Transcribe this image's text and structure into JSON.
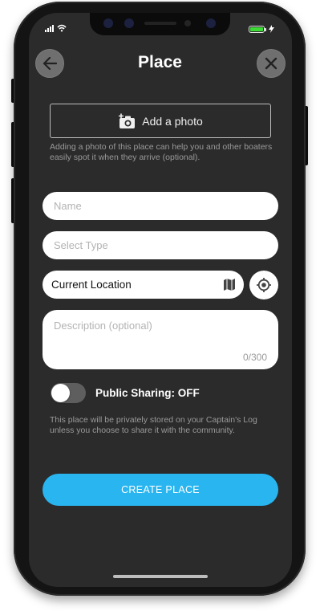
{
  "header": {
    "title": "Place",
    "back_icon": "arrow-left-icon",
    "close_icon": "close-icon"
  },
  "photo": {
    "button_label": "Add a photo",
    "icon": "add-camera-icon",
    "help_text": "Adding a photo of this place can help you and other boaters easily spot it when they arrive (optional)."
  },
  "form": {
    "name_placeholder": "Name",
    "type_placeholder": "Select Type",
    "location_value": "Current Location",
    "map_icon": "map-icon",
    "locate_icon": "crosshair-locate-icon",
    "description_placeholder": "Description (optional)",
    "description_counter": "0/300"
  },
  "sharing": {
    "label": "Public Sharing: OFF",
    "enabled": false,
    "help_text": "This place will be privately stored on your Captain's Log unless you choose to share it with the community."
  },
  "actions": {
    "create_label": "CREATE PLACE"
  },
  "colors": {
    "accent": "#29b5ef",
    "background": "#2b2b2b",
    "battery": "#3ddc35"
  }
}
